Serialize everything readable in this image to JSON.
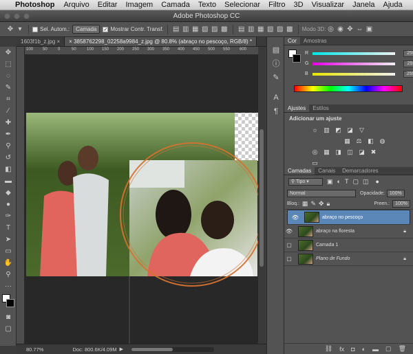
{
  "mac_menu": {
    "app": "Photoshop",
    "items": [
      "Arquivo",
      "Editar",
      "Imagem",
      "Camada",
      "Texto",
      "Selecionar",
      "Filtro",
      "3D",
      "Visualizar",
      "Janela",
      "Ajuda"
    ]
  },
  "window_title": "Adobe Photoshop CC",
  "options_bar": {
    "auto_select_label": "Sel. Autom.:",
    "auto_select_value": "Camada",
    "show_transform_label": "Mostrar Contr. Transf.",
    "mode_3d_label": "Modo 3D:"
  },
  "doc_tabs": [
    {
      "label": "1603f1b_z.jpg"
    },
    {
      "label": "3858762298_02258a9984_z.jpg @ 80.8% (abraço no pescoço, RGB/8) *"
    }
  ],
  "ruler_ticks": [
    "100",
    "50",
    "0",
    "50",
    "100",
    "150",
    "200",
    "250",
    "300",
    "350",
    "400",
    "450",
    "500",
    "550",
    "600"
  ],
  "status": {
    "zoom": "80.77%",
    "doc": "Doc: 800.6K/4.09M"
  },
  "color_panel": {
    "tabs": [
      "Cor",
      "Amostras"
    ],
    "channels": [
      {
        "label": "R",
        "value": "255",
        "color": "#00e6e6"
      },
      {
        "label": "G",
        "value": "255",
        "color": "#e600e6"
      },
      {
        "label": "B",
        "value": "255",
        "color": "#e6e600"
      }
    ]
  },
  "adjust_panel": {
    "tabs": [
      "Ajustes",
      "Estilos"
    ],
    "heading": "Adicionar um ajuste"
  },
  "layers_panel": {
    "tabs": [
      "Camadas",
      "Canais",
      "Demarcadores"
    ],
    "filter_label": "Tipo",
    "blend_mode": "Normal",
    "opacity_label": "Opacidade:",
    "opacity_value": "100%",
    "lock_label": "Bloq.:",
    "fill_label": "Preen.:",
    "fill_value": "100%",
    "layers": [
      {
        "name": "abraço no pescoço",
        "visible": true,
        "selected": true,
        "locked": false
      },
      {
        "name": "abraço na floresta",
        "visible": true,
        "selected": false,
        "locked": true
      },
      {
        "name": "Camada 1",
        "visible": false,
        "selected": false,
        "locked": false
      },
      {
        "name": "Plano de Fundo",
        "visible": false,
        "selected": false,
        "locked": true
      }
    ]
  },
  "accent_colors": {
    "selection": "#5a87b8",
    "circle_stroke": "#d4722f"
  }
}
